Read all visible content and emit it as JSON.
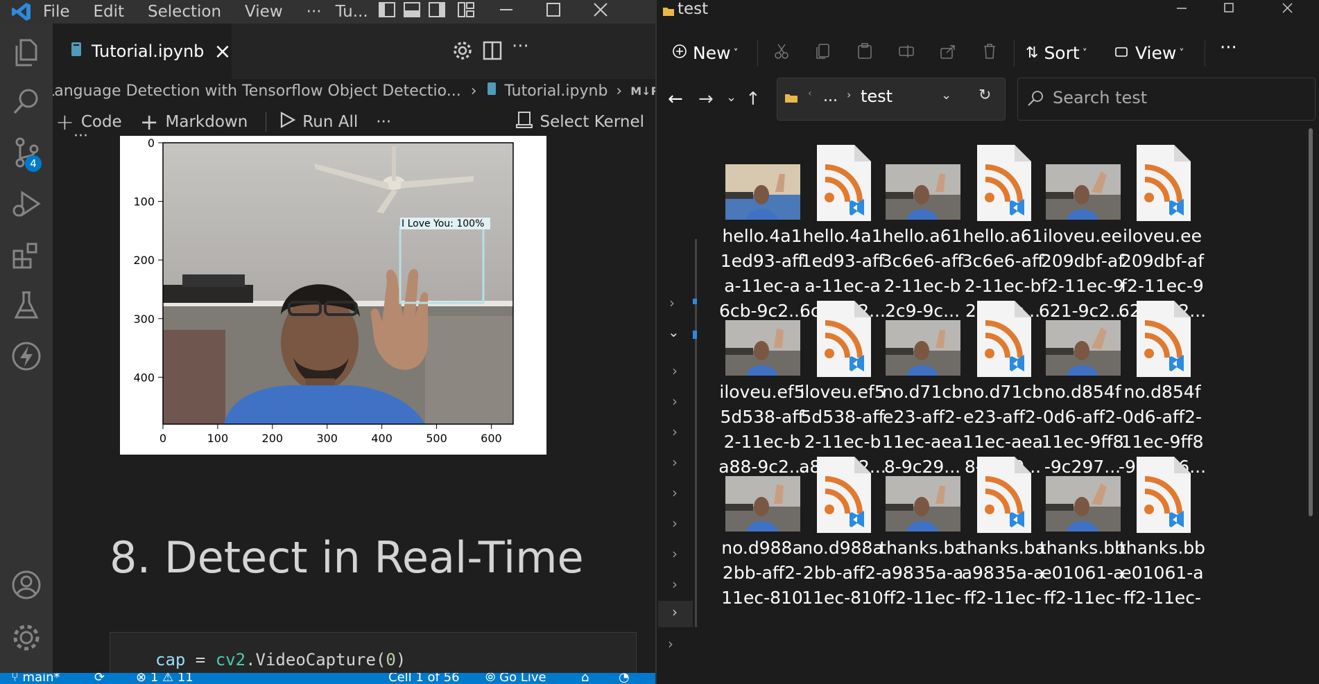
{
  "vscode": {
    "menu": [
      "File",
      "Edit",
      "Selection",
      "View",
      "···",
      "Tu..."
    ],
    "source_control_badge": "4",
    "tab": {
      "label": "Tutorial.ipynb",
      "close": "×"
    },
    "breadcrumb": {
      "segment1": "Language Detection with  Tensorflow Object Detectio...",
      "segment2": "Tutorial.ipynb",
      "segment3": "M↓R"
    },
    "toolbar": {
      "code": "Code",
      "markdown": "Markdown",
      "run_all": "Run All",
      "more": "···",
      "select_kernel": "Select Kernel"
    },
    "cell_more": "···",
    "plot": {
      "x_ticks": [
        "0",
        "100",
        "200",
        "300",
        "400",
        "500",
        "600"
      ],
      "y_ticks": [
        "0",
        "100",
        "200",
        "300",
        "400"
      ],
      "detection_label": "I Love You: 100%"
    },
    "heading": "8. Detect in Real-Time",
    "code_line": {
      "var": "cap",
      "op": " = ",
      "mod": "cv2",
      "call": ".VideoCapture(",
      "num": "0",
      "end": ")"
    },
    "status": {
      "branch": "main*",
      "errors": "1",
      "warnings": "11",
      "cell": "Cell 1 of 56",
      "golive": "Go Live"
    }
  },
  "explorer": {
    "title": "test",
    "commands": {
      "new": "New",
      "sort": "Sort",
      "view": "View",
      "more": "···"
    },
    "address": {
      "ellipsis": "...",
      "folder": "test"
    },
    "search_placeholder": "Search test",
    "files": [
      {
        "type": "image",
        "lines": [
          "hello.4a1",
          "1ed93-aff",
          "a-11ec-a",
          "6cb-9c2..."
        ]
      },
      {
        "type": "xml",
        "lines": [
          "hello.4a1",
          "1ed93-aff",
          "a-11ec-a",
          "6cb-9c2..."
        ]
      },
      {
        "type": "image",
        "lines": [
          "hello.a61",
          "3c6e6-aff",
          "2-11ec-b",
          "2c9-9c..."
        ]
      },
      {
        "type": "xml",
        "lines": [
          "hello.a61",
          "3c6e6-aff",
          "2-11ec-b",
          "2c9-9c..."
        ]
      },
      {
        "type": "image",
        "lines": [
          "iloveu.ee",
          "209dbf-af",
          "f2-11ec-9",
          "621-9c2..."
        ]
      },
      {
        "type": "xml",
        "lines": [
          "iloveu.ee",
          "209dbf-af",
          "f2-11ec-9",
          "621-9c2..."
        ]
      },
      {
        "type": "image",
        "lines": [
          "iloveu.ef5",
          "5d538-aff",
          "2-11ec-b",
          "a88-9c2..."
        ]
      },
      {
        "type": "xml",
        "lines": [
          "iloveu.ef5",
          "5d538-aff",
          "2-11ec-b",
          "a88-9c2..."
        ]
      },
      {
        "type": "image",
        "lines": [
          "no.d71cb",
          "e23-aff2-",
          "11ec-aea",
          "8-9c29..."
        ]
      },
      {
        "type": "xml",
        "lines": [
          "no.d71cb",
          "e23-aff2-",
          "11ec-aea",
          "8-9c29..."
        ]
      },
      {
        "type": "image",
        "lines": [
          "no.d854f",
          "0d6-aff2-",
          "11ec-9ff8",
          "-9c297..."
        ]
      },
      {
        "type": "xml",
        "lines": [
          "no.d854f",
          "0d6-aff2-",
          "11ec-9ff8",
          "-9c2976..."
        ]
      },
      {
        "type": "image",
        "lines": [
          "no.d988a",
          "2bb-aff2-",
          "11ec-810",
          ""
        ]
      },
      {
        "type": "xml",
        "lines": [
          "no.d988a",
          "2bb-aff2-",
          "11ec-810",
          ""
        ]
      },
      {
        "type": "image",
        "lines": [
          "thanks.ba",
          "a9835a-a",
          "ff2-11ec-",
          ""
        ]
      },
      {
        "type": "xml",
        "lines": [
          "thanks.ba",
          "a9835a-a",
          "ff2-11ec-",
          ""
        ]
      },
      {
        "type": "image",
        "lines": [
          "thanks.bb",
          "e01061-a",
          "ff2-11ec-",
          ""
        ]
      },
      {
        "type": "xml",
        "lines": [
          "thanks.bb",
          "e01061-a",
          "ff2-11ec-",
          ""
        ]
      }
    ]
  },
  "colors": {
    "accent": "#007acc",
    "rss_orange": "#e07a2f",
    "vscode_blue": "#2a8be0"
  }
}
